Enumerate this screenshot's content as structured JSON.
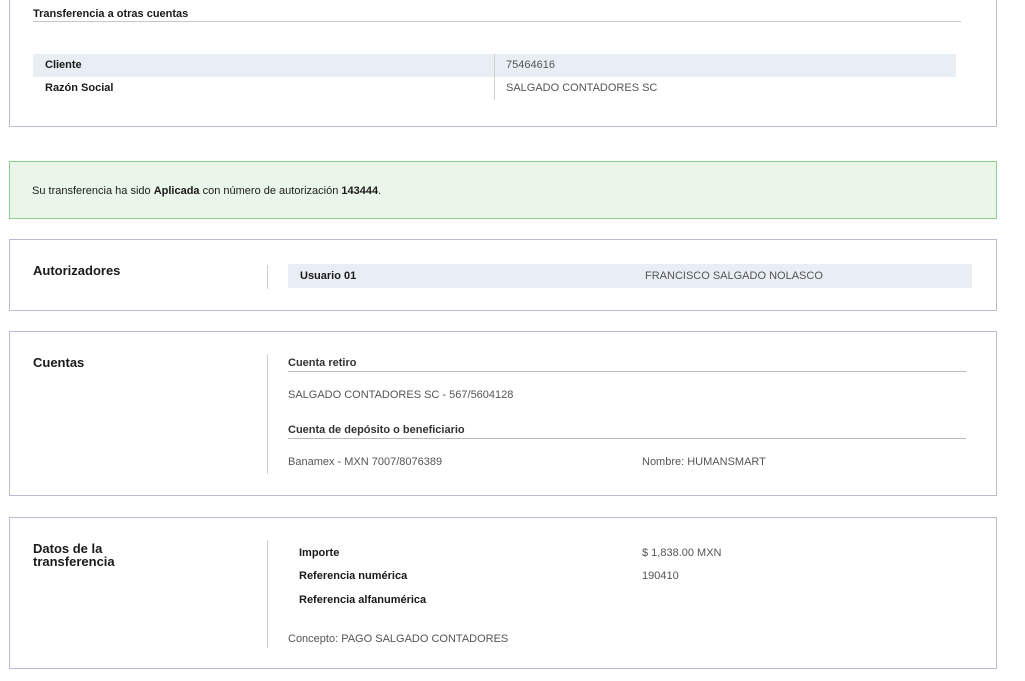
{
  "header": {
    "title": "Transferencia a otras cuentas",
    "client_rows": [
      {
        "label": "Cliente",
        "value": "75464616"
      },
      {
        "label": "Razón Social",
        "value": "SALGADO CONTADORES SC"
      }
    ]
  },
  "alert": {
    "prefix": "Su transferencia ha sido ",
    "status": "Aplicada",
    "middle": " con número de autorización ",
    "auth_number": "143444",
    "suffix": ".",
    "color": "#eaf6ea"
  },
  "autorizadores": {
    "title": "Autorizadores",
    "user_label": "Usuario 01",
    "user_name": "FRANCISCO SALGADO NOLASCO"
  },
  "cuentas": {
    "title": "Cuentas",
    "retiro_label": "Cuenta retiro",
    "retiro_value": "SALGADO CONTADORES SC - 567/5604128",
    "deposito_label": "Cuenta de depósito o beneficiario",
    "deposito_value": "Banamex - MXN 7007/8076389",
    "beneficiario_nombre": "Nombre: HUMANSMART"
  },
  "datos": {
    "title_line1": "Datos de la",
    "title_line2": "transferencia",
    "importe_label": "Importe",
    "importe_value": "$ 1,838.00 MXN",
    "ref_num_label": "Referencia numérica",
    "ref_num_value": "190410",
    "ref_alfa_label": "Referencia alfanumérica",
    "concepto": "Concepto: PAGO SALGADO CONTADORES"
  }
}
